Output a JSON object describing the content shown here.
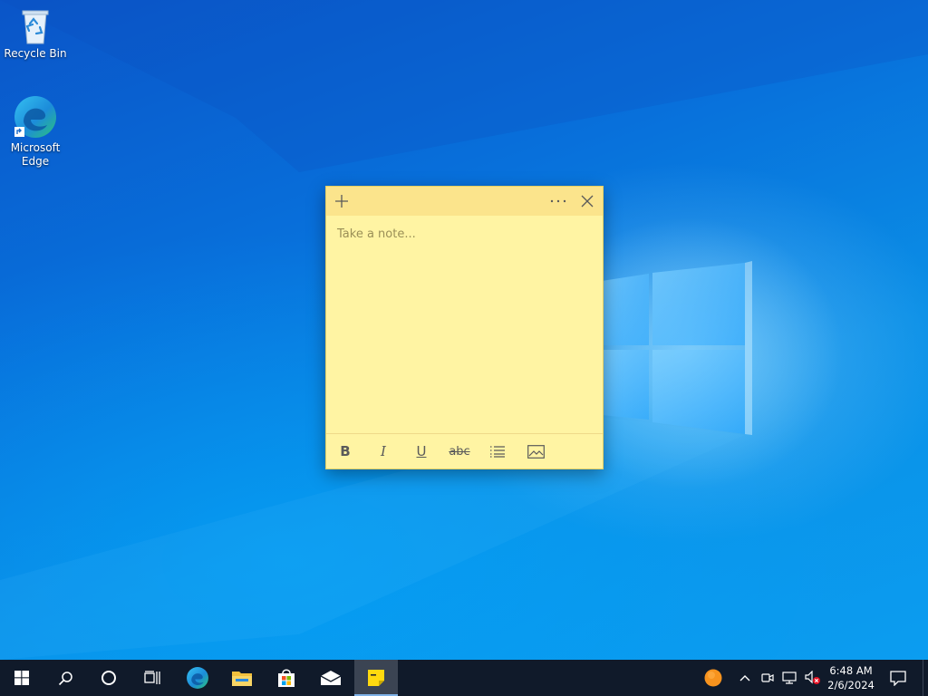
{
  "desktop": {
    "icons": [
      {
        "label": "Recycle Bin",
        "icon": "recycle-bin-icon"
      },
      {
        "label": "Microsoft Edge",
        "icon": "edge-icon"
      }
    ]
  },
  "sticky_note": {
    "placeholder": "Take a note...",
    "titlebar": {
      "add": "plus-icon",
      "menu": "more-icon",
      "close": "close-icon"
    },
    "toolbar": {
      "bold": "B",
      "italic": "I",
      "underline": "U",
      "strikethrough": "abc",
      "list": "bullet-list-icon",
      "image": "image-icon"
    },
    "colors": {
      "body": "#fff4a3",
      "titlebar": "#fbe48c"
    }
  },
  "taskbar": {
    "items": [
      "windows-icon",
      "search-icon",
      "cortana-icon",
      "task-view-icon",
      "edge-icon",
      "file-explorer-icon",
      "store-icon",
      "mail-icon",
      "sticky-notes-icon"
    ],
    "active_item": "sticky-notes-icon",
    "tray": [
      "orange-circle-icon",
      "chevron-up-icon",
      "meet-now-icon",
      "network-icon",
      "volume-muted-icon"
    ],
    "clock": {
      "time": "6:48 AM",
      "date": "2/6/2024"
    },
    "notification_icon": "notification-icon"
  }
}
